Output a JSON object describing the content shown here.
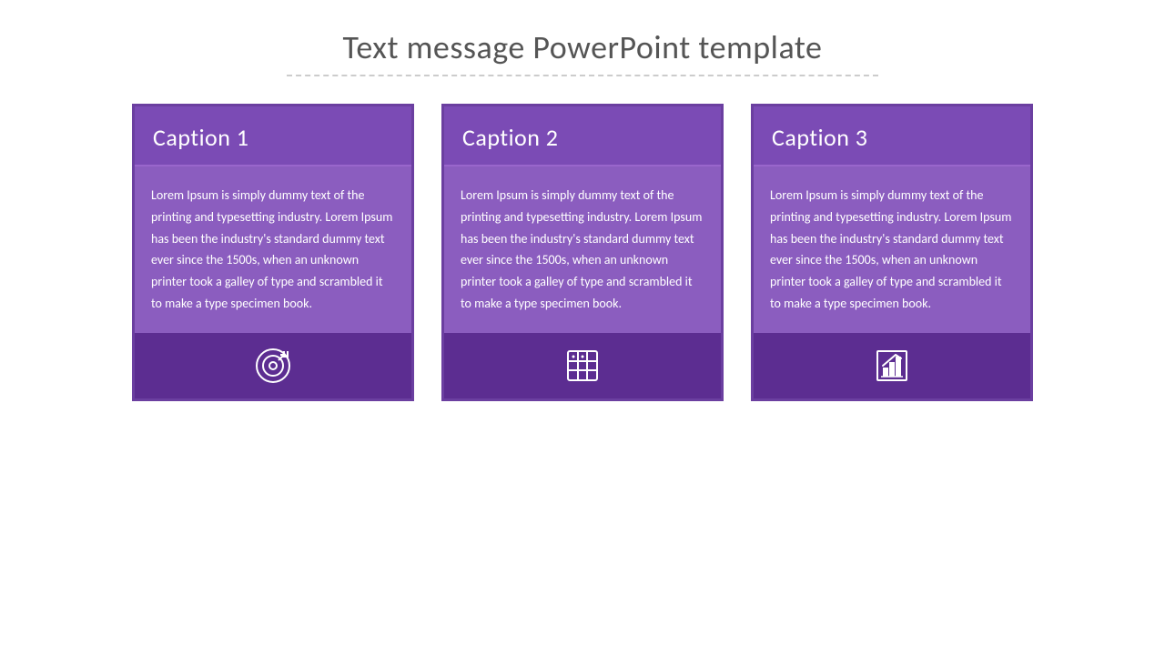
{
  "page": {
    "title": "Text message PowerPoint template"
  },
  "cards": [
    {
      "id": "card-1",
      "caption": "Caption 1",
      "text": "Lorem Ipsum is simply dummy text of the printing and typesetting industry. Lorem Ipsum has been the industry's standard dummy text ever since the 1500s, when an unknown printer took a galley of type and scrambled it to make a type specimen book.",
      "icon": "target"
    },
    {
      "id": "card-2",
      "caption": "Caption 2",
      "text": "Lorem Ipsum is simply dummy text of the printing and typesetting industry. Lorem Ipsum has been the industry's standard dummy text ever since the 1500s, when an unknown printer took a galley of type and scrambled it to make a type specimen book.",
      "icon": "table"
    },
    {
      "id": "card-3",
      "caption": "Caption 3",
      "text": "Lorem Ipsum is simply dummy text of the printing and typesetting industry. Lorem Ipsum has been the industry's standard dummy text ever since the 1500s, when an unknown printer took a galley of type and scrambled it to make a type specimen book.",
      "icon": "chart"
    }
  ]
}
